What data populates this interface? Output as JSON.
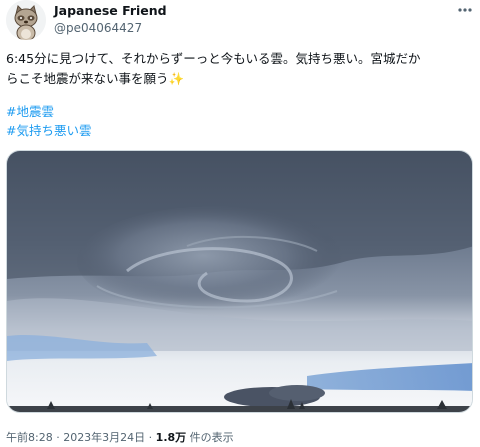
{
  "post": {
    "author_name": "Japanese Friend",
    "author_handle": "@pe04064427",
    "text": "6:45分に見つけて、それからずーっと今もいる雲。気持ち悪い。宮城だか\nらこそ地震が来ない事を願う✨",
    "hashtags": [
      "#地震雲",
      "#気持ち悪い雲"
    ],
    "time_date": "午前8:28 · 2023年3月24日 · ",
    "views_count": "1.8万",
    "views_label": " 件の表示"
  },
  "icons": {
    "more": "more-dots-icon",
    "avatar": "tanuki-avatar"
  },
  "colors": {
    "link": "#1d9bf0",
    "text": "#0f1419",
    "muted": "#536471"
  }
}
